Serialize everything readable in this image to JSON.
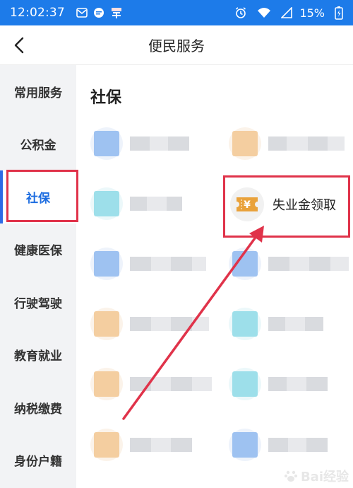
{
  "status_bar": {
    "time": "12:02:37",
    "battery": "15%",
    "left_icons": [
      "mail-icon",
      "chat-bubble-icon",
      "app-notification-icon"
    ],
    "right_icons": [
      "alarm-icon",
      "wifi-icon",
      "cell-signal-icon",
      "battery-charging-icon"
    ]
  },
  "nav": {
    "title": "便民服务",
    "back_icon": "chevron-left-icon"
  },
  "sidebar": {
    "items": [
      {
        "label": "常用服务"
      },
      {
        "label": "公积金"
      },
      {
        "label": "社保",
        "active": true
      },
      {
        "label": "健康医保"
      },
      {
        "label": "行驶驾驶"
      },
      {
        "label": "教育就业"
      },
      {
        "label": "纳税缴费"
      },
      {
        "label": "身份户籍"
      }
    ]
  },
  "main": {
    "section_title": "社保",
    "highlighted_service": {
      "label": "失业金领取",
      "icon": "yuan-ticket-icon"
    }
  },
  "colors": {
    "status_bar": "#1d7be9",
    "active_text": "#1d6de0",
    "accent_bar": "#2f6be6",
    "annotation": "#e0334a",
    "icon_blue": "#8fb8ef",
    "icon_orange": "#f2c793",
    "icon_cyan": "#8fdbe6",
    "yuan_orange": "#e9a23b"
  },
  "watermark": {
    "text": "Bai经验"
  }
}
